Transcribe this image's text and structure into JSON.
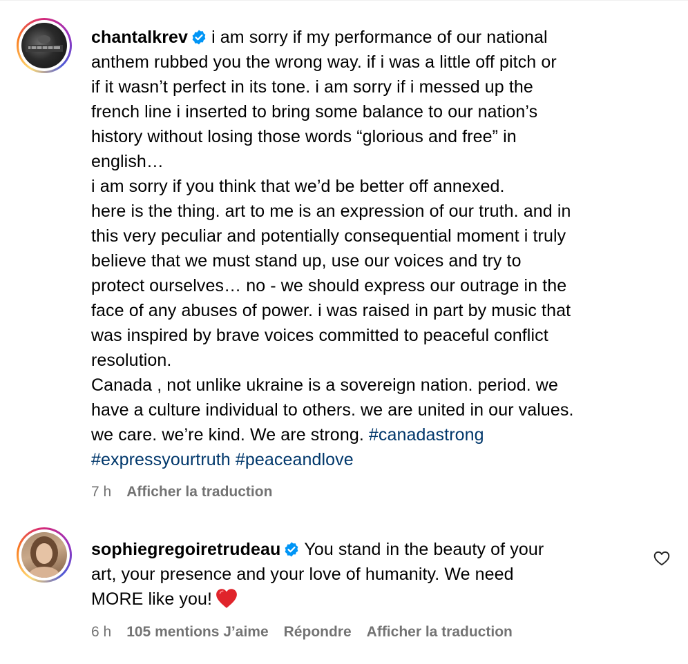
{
  "comments": [
    {
      "username": "chantalkrev",
      "verified": true,
      "lines": [
        "i am sorry if my performance of our national",
        "anthem rubbed you the wrong way. if i was a little off pitch or",
        "if it wasn’t perfect in its tone. i am sorry if i messed up the",
        "french line i inserted to bring some balance to our nation’s",
        "history without losing those words “glorious and free” in",
        "english…",
        "i am sorry if you think that we’d be better off annexed.",
        "here is the thing. art to me is an expression of our truth. and in",
        "this very peculiar and potentially consequential moment i truly",
        "believe that we must stand up, use our voices and try to",
        "protect ourselves… no - we should express our outrage in the",
        "face of any abuses of power. i was raised in part by music that",
        "was inspired by brave voices committed to peaceful conflict",
        "resolution.",
        "Canada , not unlike ukraine is a sovereign nation. period. we",
        "have a culture individual to others. we are united in our values.",
        "we care. we’re kind. We are strong. "
      ],
      "hashtags": [
        "#canadastrong",
        "#expressyourtruth",
        "#peaceandlove"
      ],
      "time": "7 h",
      "translate": "Afficher la traduction"
    },
    {
      "username": "sophiegregoiretrudeau",
      "verified": true,
      "lines": [
        "You stand in the beauty of your",
        "art, your presence and your love of humanity. We need",
        "MORE like you!"
      ],
      "emoji": "red-heart",
      "time": "6 h",
      "likes": "105 mentions J’aime",
      "reply": "Répondre",
      "translate": "Afficher la traduction"
    }
  ],
  "colors": {
    "text": "#000000",
    "meta": "#737373",
    "hashtag": "#00376b",
    "verified": "#0095f6"
  },
  "icons": [
    "verified-badge-icon",
    "like-heart-icon",
    "red-heart-emoji"
  ]
}
